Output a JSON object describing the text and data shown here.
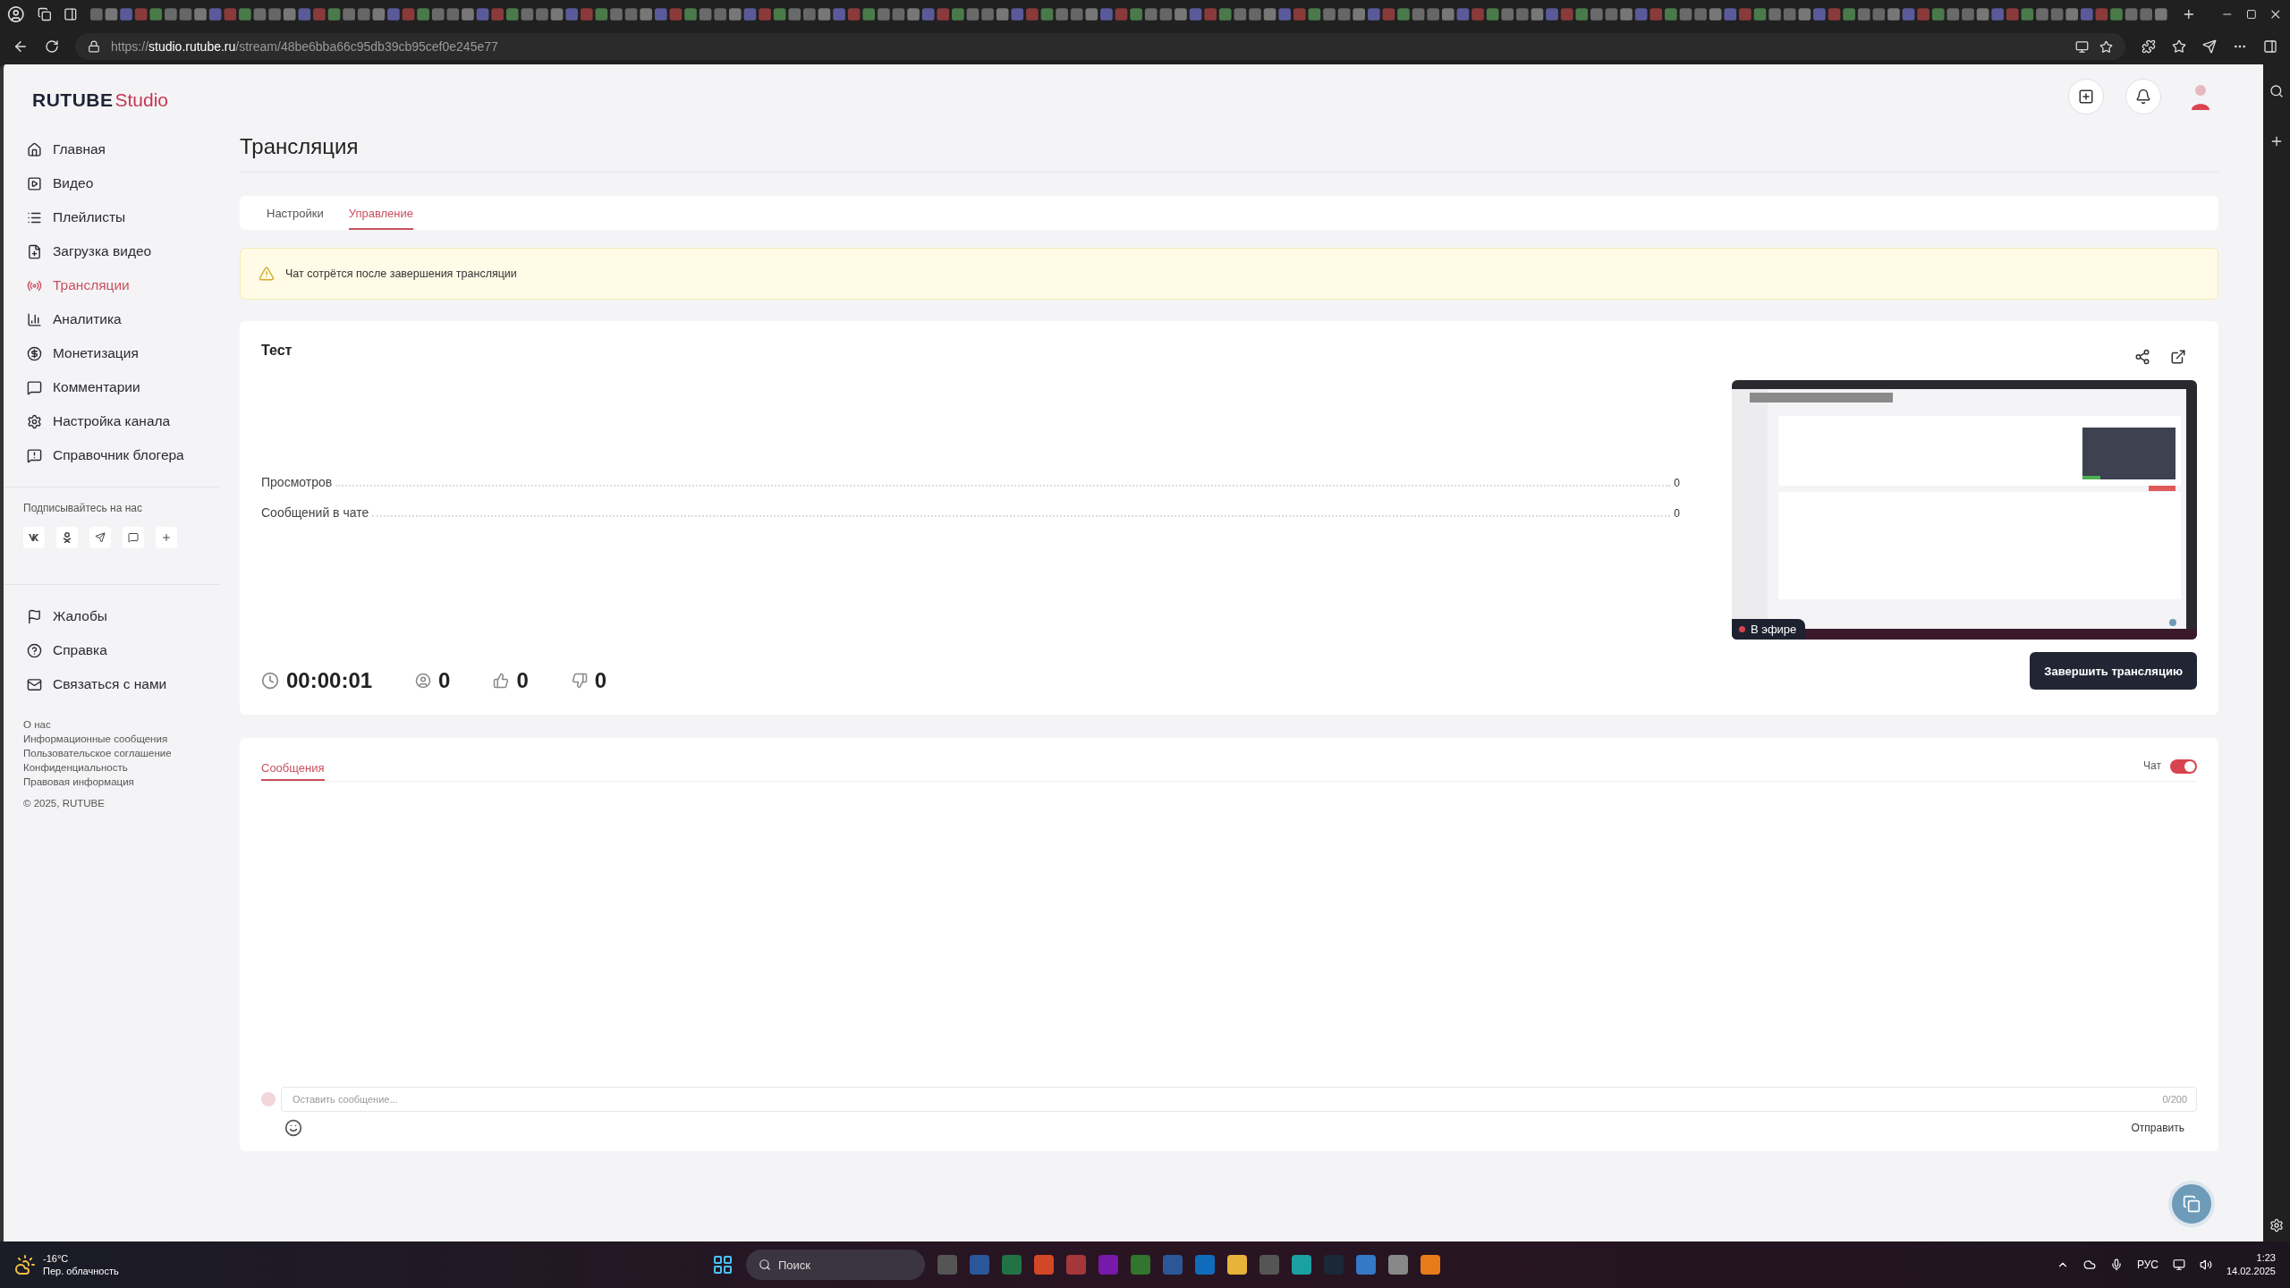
{
  "browser": {
    "url": "https://**studio.rutube.ru**/stream/48be6bba66c95db39cb95cef0e245e77"
  },
  "sidebar": {
    "logo": {
      "brand": "RUTUBE",
      "product": "Studio"
    },
    "nav": [
      {
        "label": "Главная",
        "selected": false
      },
      {
        "label": "Видео",
        "selected": false
      },
      {
        "label": "Плейлисты",
        "selected": false
      },
      {
        "label": "Загрузка видео",
        "selected": false
      },
      {
        "label": "Трансляции",
        "selected": true
      },
      {
        "label": "Аналитика",
        "selected": false
      },
      {
        "label": "Монетизация",
        "selected": false
      },
      {
        "label": "Комментарии",
        "selected": false
      },
      {
        "label": "Настройка канала",
        "selected": false
      },
      {
        "label": "Справочник блогера",
        "selected": false
      }
    ],
    "social_title": "Подписывайтесь на нас",
    "help_nav": [
      {
        "label": "Жалобы"
      },
      {
        "label": "Справка"
      },
      {
        "label": "Связаться с нами"
      }
    ],
    "footer_links": [
      "О нас",
      "Информационные сообщения",
      "Пользовательское соглашение",
      "Конфиденциальность",
      "Правовая информация"
    ],
    "copyright": "© 2025, RUTUBE"
  },
  "page": {
    "title": "Трансляция",
    "tabs": [
      {
        "label": "Настройки",
        "selected": false
      },
      {
        "label": "Управление",
        "selected": true
      }
    ],
    "warning": "Чат сотрётся после завершения трансляции",
    "stream": {
      "title": "Тест",
      "stats": [
        {
          "label": "Просмотров",
          "value": "0"
        },
        {
          "label": "Сообщений в чате",
          "value": "0"
        }
      ],
      "timer": "00:00:01",
      "viewers": "0",
      "likes": "0",
      "dislikes": "0",
      "live_badge": "В эфире",
      "end_button": "Завершить трансляцию"
    },
    "chat": {
      "tabs": [
        {
          "label": "Сообщения",
          "selected": true
        }
      ],
      "toggle": {
        "label": "Чат",
        "on": true
      },
      "placeholder": "Оставить сообщение...",
      "counter": "0/200",
      "send": "Отправить"
    }
  },
  "taskbar": {
    "temperature": "-16°C",
    "weather": "Пер. облачность",
    "search_placeholder": "Поиск",
    "language": "РУС",
    "time": "1:23",
    "date": "14.02.2025"
  }
}
